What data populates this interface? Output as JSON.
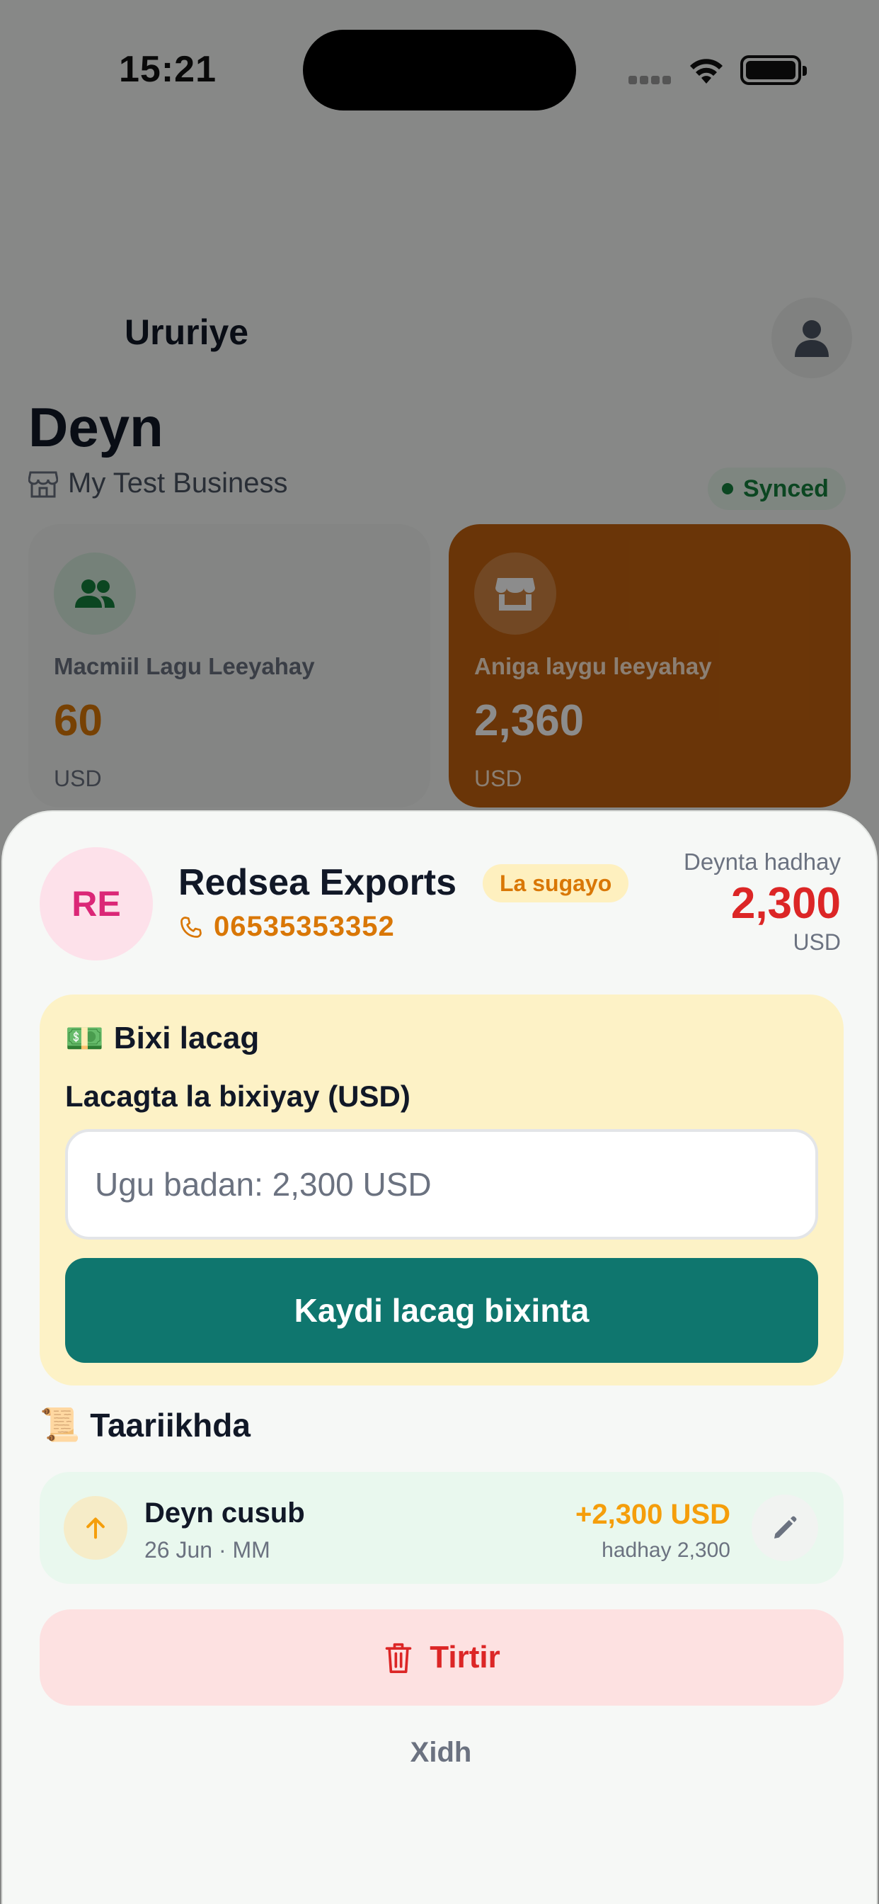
{
  "status_bar": {
    "time": "15:21"
  },
  "header": {
    "title": "Ururiye"
  },
  "page": {
    "heading": "Deyn",
    "business_name": "My Test Business",
    "sync_status": "Synced"
  },
  "cards": [
    {
      "label": "Macmiil Lagu Leeyahay",
      "value": "60",
      "currency": "USD",
      "icon": "users-icon"
    },
    {
      "label": "Aniga laygu leeyahay",
      "value": "2,360",
      "currency": "USD",
      "icon": "store-icon"
    }
  ],
  "sheet": {
    "avatar_initials": "RE",
    "customer_name": "Redsea Exports",
    "status_badge": "La sugayo",
    "phone": "06535353352",
    "debt_label": "Deynta hadhay",
    "debt_value": "2,300",
    "debt_currency": "USD",
    "payment": {
      "title": "Bixi lacag",
      "title_emoji": "💵",
      "field_label": "Lacagta la bixiyay (USD)",
      "placeholder": "Ugu badan: 2,300 USD",
      "submit_label": "Kaydi lacag bixinta"
    },
    "history": {
      "title": "Taariikhda",
      "title_emoji": "📜",
      "items": [
        {
          "title": "Deyn cusub",
          "meta": "26 Jun · MM",
          "amount": "+2,300 USD",
          "balance": "hadhay 2,300"
        }
      ]
    },
    "delete_label": "Tirtir",
    "close_label": "Xidh"
  },
  "colors": {
    "accent_teal": "#0f766e",
    "warning_amber": "#d97706",
    "danger_red": "#dc2626",
    "card_orange": "#c2620f"
  }
}
